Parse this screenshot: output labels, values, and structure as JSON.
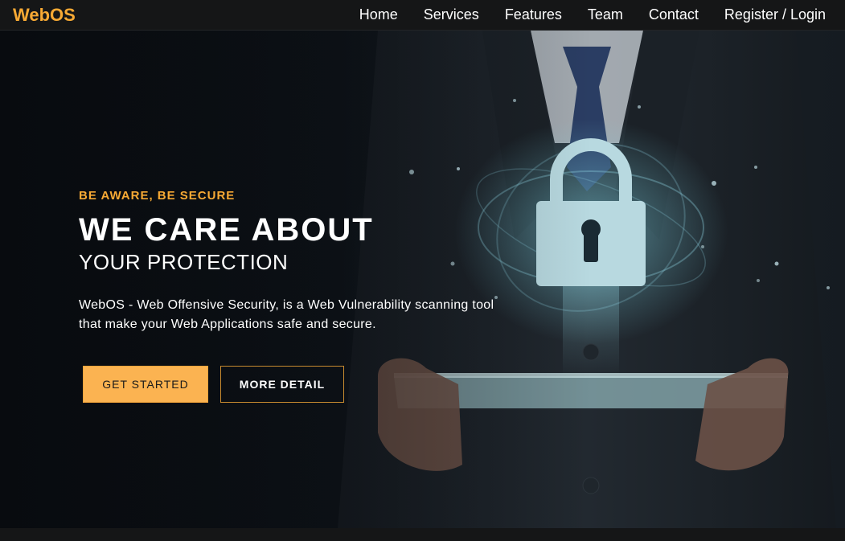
{
  "brand": {
    "name": "WebOS"
  },
  "nav": {
    "items": [
      {
        "label": "Home"
      },
      {
        "label": "Services"
      },
      {
        "label": "Features"
      },
      {
        "label": "Team"
      },
      {
        "label": "Contact"
      },
      {
        "label": "Register / Login"
      }
    ]
  },
  "hero": {
    "eyebrow": "BE AWARE, BE SECURE",
    "headline": "WE CARE ABOUT",
    "subheadline": "YOUR PROTECTION",
    "description": "WebOS - Web Offensive Security, is a Web Vulnerability scanning tool that make your Web Applications safe and secure.",
    "primary_button": "GET STARTED",
    "secondary_button": "MORE DETAIL",
    "image_icon": "padlock-icon"
  },
  "colors": {
    "accent": "#f7a934",
    "button_primary": "#fbb351",
    "navbar": "#151617",
    "hero_bg": "#0b0e12"
  }
}
